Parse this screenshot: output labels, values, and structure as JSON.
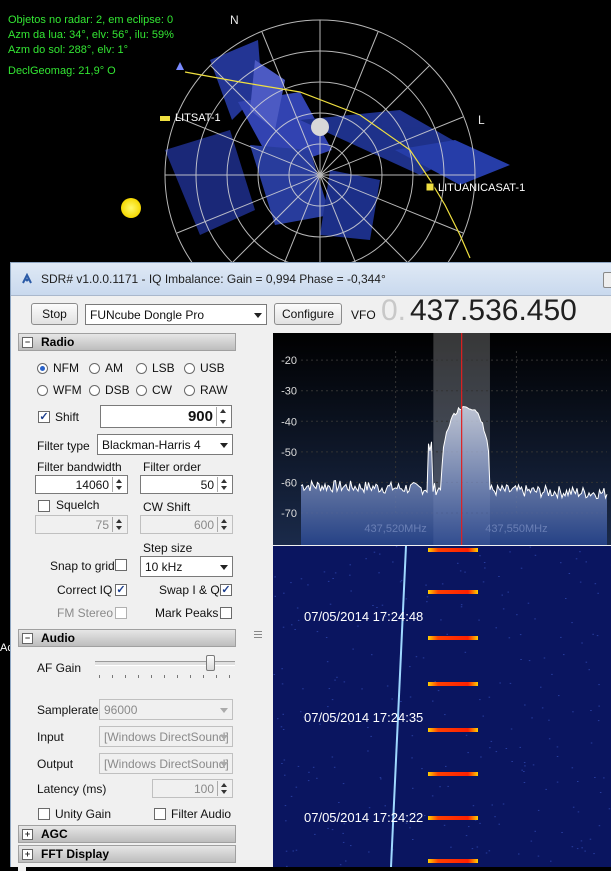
{
  "radar": {
    "info_lines": [
      "Objetos no radar: 2, em eclipse: 0",
      "Azm da lua: 34°, elv: 56°, ilu: 59%",
      "Azm do sol: 288°, elv: 1°"
    ],
    "declination": "DeclGeomag: 21,9° O",
    "compass_n": "N",
    "compass_l": "L",
    "satellites": [
      "LITSAT-1",
      "LITUANICASAT-1"
    ]
  },
  "window": {
    "title": "SDR# v1.0.0.1171 - IQ Imbalance: Gain = 0,994 Phase = -0,344°"
  },
  "toolbar": {
    "stop_label": "Stop",
    "device": "FUNcube Dongle Pro",
    "configure_label": "Configure",
    "vfo_label": "VFO",
    "vfo_value_dim": "0.",
    "vfo_value": "437.536.450"
  },
  "radio": {
    "section_label": "Radio",
    "modes": [
      "NFM",
      "AM",
      "LSB",
      "USB",
      "WFM",
      "DSB",
      "CW",
      "RAW"
    ],
    "selected_mode": "NFM",
    "shift_label": "Shift",
    "shift_checked": true,
    "shift_value": "900",
    "filter_type_label": "Filter type",
    "filter_type": "Blackman-Harris 4",
    "filter_bandwidth_label": "Filter bandwidth",
    "filter_bandwidth": "14060",
    "filter_order_label": "Filter order",
    "filter_order": "50",
    "squelch_label": "Squelch",
    "squelch_checked": false,
    "squelch_value": "75",
    "cw_shift_label": "CW Shift",
    "cw_shift_value": "600",
    "step_size_label": "Step size",
    "step_size": "10 kHz",
    "snap_to_grid_label": "Snap to grid",
    "snap_to_grid_checked": false,
    "correct_iq_label": "Correct IQ",
    "correct_iq_checked": true,
    "swap_iq_label": "Swap I & Q",
    "swap_iq_checked": true,
    "fm_stereo_label": "FM Stereo",
    "fm_stereo_checked": false,
    "mark_peaks_label": "Mark Peaks",
    "mark_peaks_checked": false
  },
  "audio": {
    "section_label": "Audio",
    "af_gain_label": "AF Gain",
    "af_gain_level": 0.85,
    "samplerate_label": "Samplerate",
    "samplerate": "96000",
    "input_label": "Input",
    "input_value": "[Windows DirectSound]",
    "output_label": "Output",
    "output_value": "[Windows DirectSound]",
    "latency_label": "Latency (ms)",
    "latency_value": "100",
    "unity_gain_label": "Unity Gain",
    "unity_gain_checked": false,
    "filter_audio_label": "Filter Audio",
    "filter_audio_checked": false
  },
  "agc": {
    "section_label": "AGC"
  },
  "fft": {
    "section_label": "FFT Display"
  },
  "chart_data": {
    "type": "line",
    "y_ticks": [
      "-20",
      "-30",
      "-40",
      "-50",
      "-60",
      "-70"
    ],
    "ylim": [
      -70,
      -17
    ],
    "x_ticks": [
      "437,520MHz",
      "437,550MHz"
    ],
    "x_tick_values_mhz": [
      437.52,
      437.55
    ],
    "xlim_mhz": [
      437.4965,
      437.5725
    ],
    "center_mhz": 437.5364,
    "noise_floor_db": -61,
    "signal_peak_db": -35,
    "signal_width_khz": 14.06,
    "side_spike_mhz": 437.5285,
    "side_spike_db": -50
  },
  "waterfall": {
    "timestamps": [
      "07/05/2014 17:24:48",
      "07/05/2014 17:24:35",
      "07/05/2014 17:24:22"
    ]
  },
  "left_edge_text": "Ac"
}
